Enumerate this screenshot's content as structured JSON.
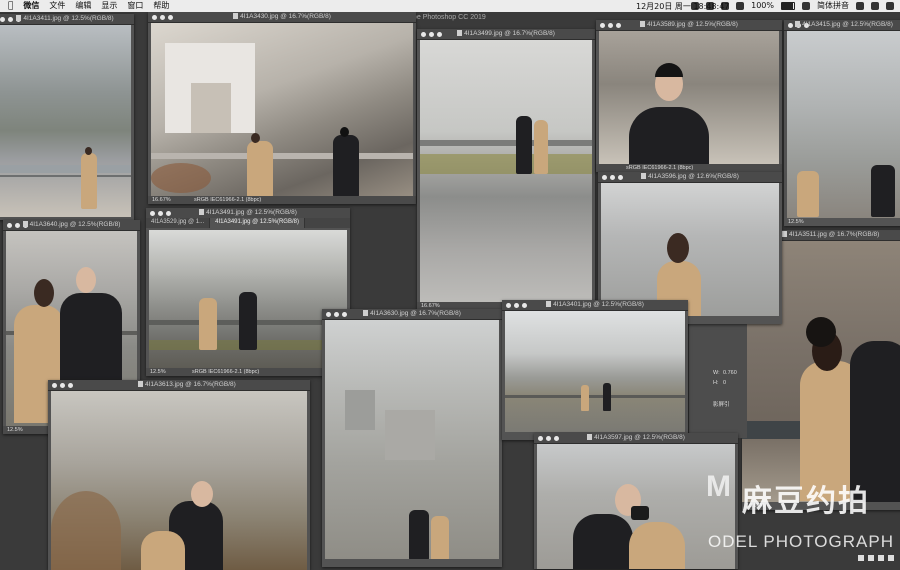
{
  "menubar": {
    "apple": "",
    "app_name": "微信",
    "menus": [
      "文件",
      "编辑",
      "显示",
      "窗口",
      "帮助"
    ],
    "battery": "100%",
    "datetime": "12月20日 周一 18:48:47",
    "input_method": "简体拼音"
  },
  "app_title": "be Photoshop CC 2019",
  "windows": [
    {
      "title": "4I1A3411.jpg @ 12.5%(RGB/8)"
    },
    {
      "title": "4I1A3430.jpg @ 16.7%(RGB/8)",
      "zoom": "16.67%",
      "profile": "sRGB IEC61966-2.1 (8bpc)"
    },
    {
      "title": "4I1A3499.jpg @ 16.7%(RGB/8)",
      "zoom": "16.67%"
    },
    {
      "title": "4I1A3589.jpg @ 12.5%(RGB/8)",
      "profile": "sRGB IEC61966-2.1 (8bpc)"
    },
    {
      "title": "4I1A3415.jpg @ 12.5%(RGB/8)",
      "zoom": "12.5%"
    },
    {
      "title": "4I1A3596.jpg @ 12.6%(RGB/8)"
    },
    {
      "title": "4I1A3511.jpg @ 16.7%(RGB/8)"
    },
    {
      "title": "4I1A3640.jpg @ 12.5%(RGB/8)",
      "zoom": "12.5%"
    },
    {
      "title": "4I1A3491.jpg @ 12.5%(RGB/8)",
      "tabs": [
        "4I1A3529.jpg @ 1...",
        "4I1A3491.jpg @ 12.5%(RGB/8)"
      ],
      "zoom": "12.5%",
      "profile": "sRGB IEC61966-2.1 (8bpc)"
    },
    {
      "title": "4I1A3630.jpg @ 16.7%(RGB/8)"
    },
    {
      "title": "4I1A3401.jpg @ 12.5%(RGB/8)"
    },
    {
      "title": "4I1A3613.jpg @ 16.7%(RGB/8)"
    },
    {
      "title": "4I1A3597.jpg @ 12.5%(RGB/8)"
    },
    {
      "title": "",
      "zoom": "16.67%"
    }
  ],
  "panel": {
    "h": "H:",
    "w": "W:",
    "h_val": "0.760",
    "y_val": "0",
    "x_val": "0",
    "label": "影屏引"
  },
  "watermark": {
    "cn": "麻豆约拍",
    "en": "ODEL PHOTOGRAPH",
    "mark": "M"
  },
  "colors": {
    "menubar": "#ececec",
    "window_chrome": "#4a4a4a",
    "background": "#3a3a3a"
  }
}
